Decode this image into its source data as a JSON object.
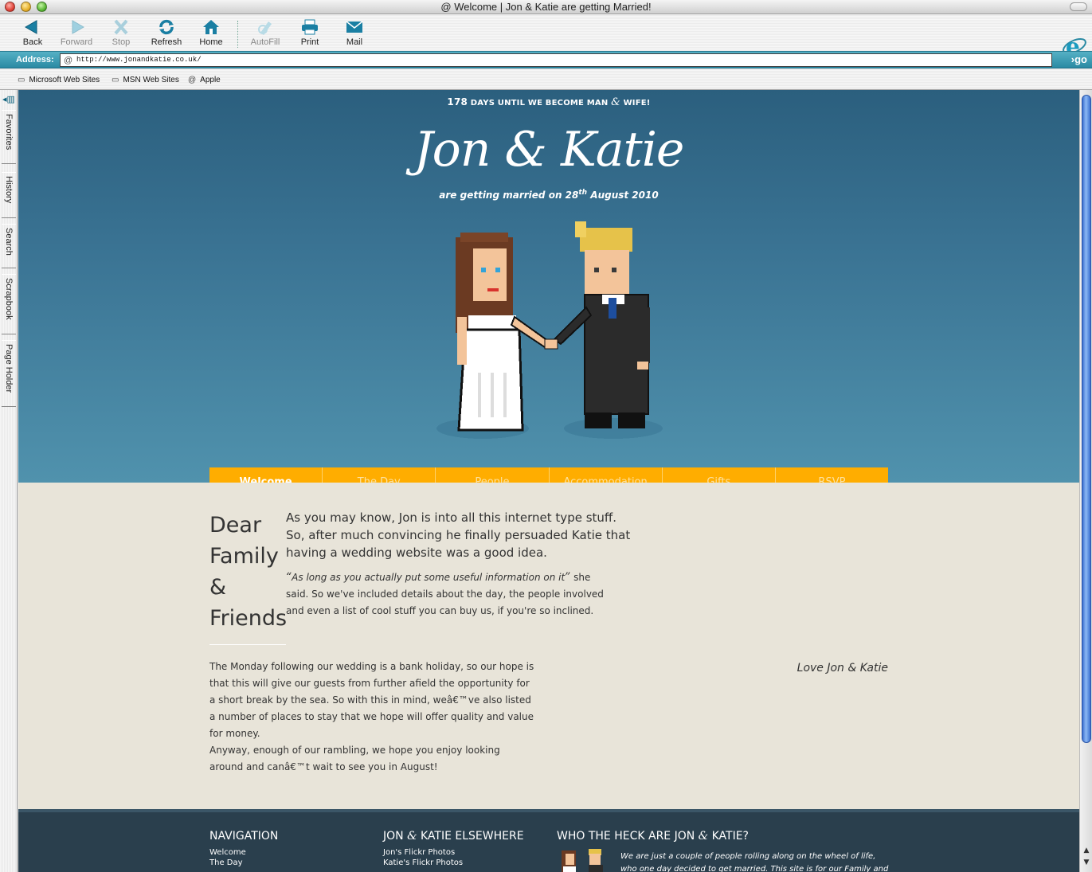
{
  "window": {
    "title": "Welcome | Jon & Katie are getting Married!"
  },
  "toolbar": {
    "back": "Back",
    "forward": "Forward",
    "stop": "Stop",
    "refresh": "Refresh",
    "home": "Home",
    "autofill": "AutoFill",
    "print": "Print",
    "mail": "Mail"
  },
  "address": {
    "label": "Address:",
    "url": "http://www.jonandkatie.co.uk/",
    "go": "go"
  },
  "links": [
    "Microsoft Web Sites",
    "MSN Web Sites",
    "Apple"
  ],
  "sidebar": {
    "tabs": [
      "Favorites",
      "History",
      "Search",
      "Scrapbook",
      "Page Holder"
    ]
  },
  "hero": {
    "count": "178",
    "count_text_a": "DAYS UNTIL WE BECOME MAN",
    "count_amp": "&",
    "count_text_b": "WIFE!",
    "names": "Jon & Katie",
    "married_prefix": "are getting married on",
    "day": "28",
    "day_suffix": "th",
    "month_year": "August 2010"
  },
  "nav": {
    "items": [
      {
        "label": "Welcome",
        "active": true
      },
      {
        "label": "The Day"
      },
      {
        "label": "People"
      },
      {
        "label": "Accommodation"
      },
      {
        "label": "Gifts"
      },
      {
        "label": "RSVP"
      }
    ]
  },
  "content": {
    "dear_lines": [
      "Dear",
      "Family",
      "&",
      "Friends"
    ],
    "lead": "As you may know, Jon is into all this internet type stuff. So, after much convincing he finally persuaded Katie that having a wedding website was a good idea.",
    "quote_open": "“",
    "quote": "As long as you actually put some useful information on it",
    "quote_close": "”",
    "quote_after": " she said. So we've included details about the day, the people involved and even a list of cool stuff you can buy us, if you're so inclined.",
    "para1": "The Monday following our wedding is a bank holiday, so our hope is that this will give our guests from further afield the opportunity for a short break by the sea. So with this in mind, weâ€™ve also listed a number of places to stay that we hope will offer quality and value for money.",
    "para2": "Anyway, enough of our rambling, we hope you enjoy looking around and canâ€™t wait to see you in August!",
    "signoff": "Love Jon & Katie"
  },
  "footer": {
    "nav_heading": "NAVIGATION",
    "nav_links": [
      "Welcome",
      "The Day"
    ],
    "elsewhere_heading_a": "JON",
    "elsewhere_heading_amp": "&",
    "elsewhere_heading_b": "KATIE ELSEWHERE",
    "elsewhere_links": [
      "Jon's Flickr Photos",
      "Katie's Flickr Photos"
    ],
    "who_heading_a": "WHO THE HECK ARE JON",
    "who_heading_amp": "&",
    "who_heading_b": "KATIE?",
    "who_text": "We are just a couple of people rolling along on the wheel of life, who one day decided to get married. This site is for our Family and"
  },
  "colors": {
    "hero_top": "#2b5f7e",
    "hero_bottom": "#5092ad",
    "nav_bg": "#ffad00",
    "content_bg": "#e8e4d9",
    "footer_bg": "#2a3f4d",
    "address_bar": "#2a8aa3"
  }
}
